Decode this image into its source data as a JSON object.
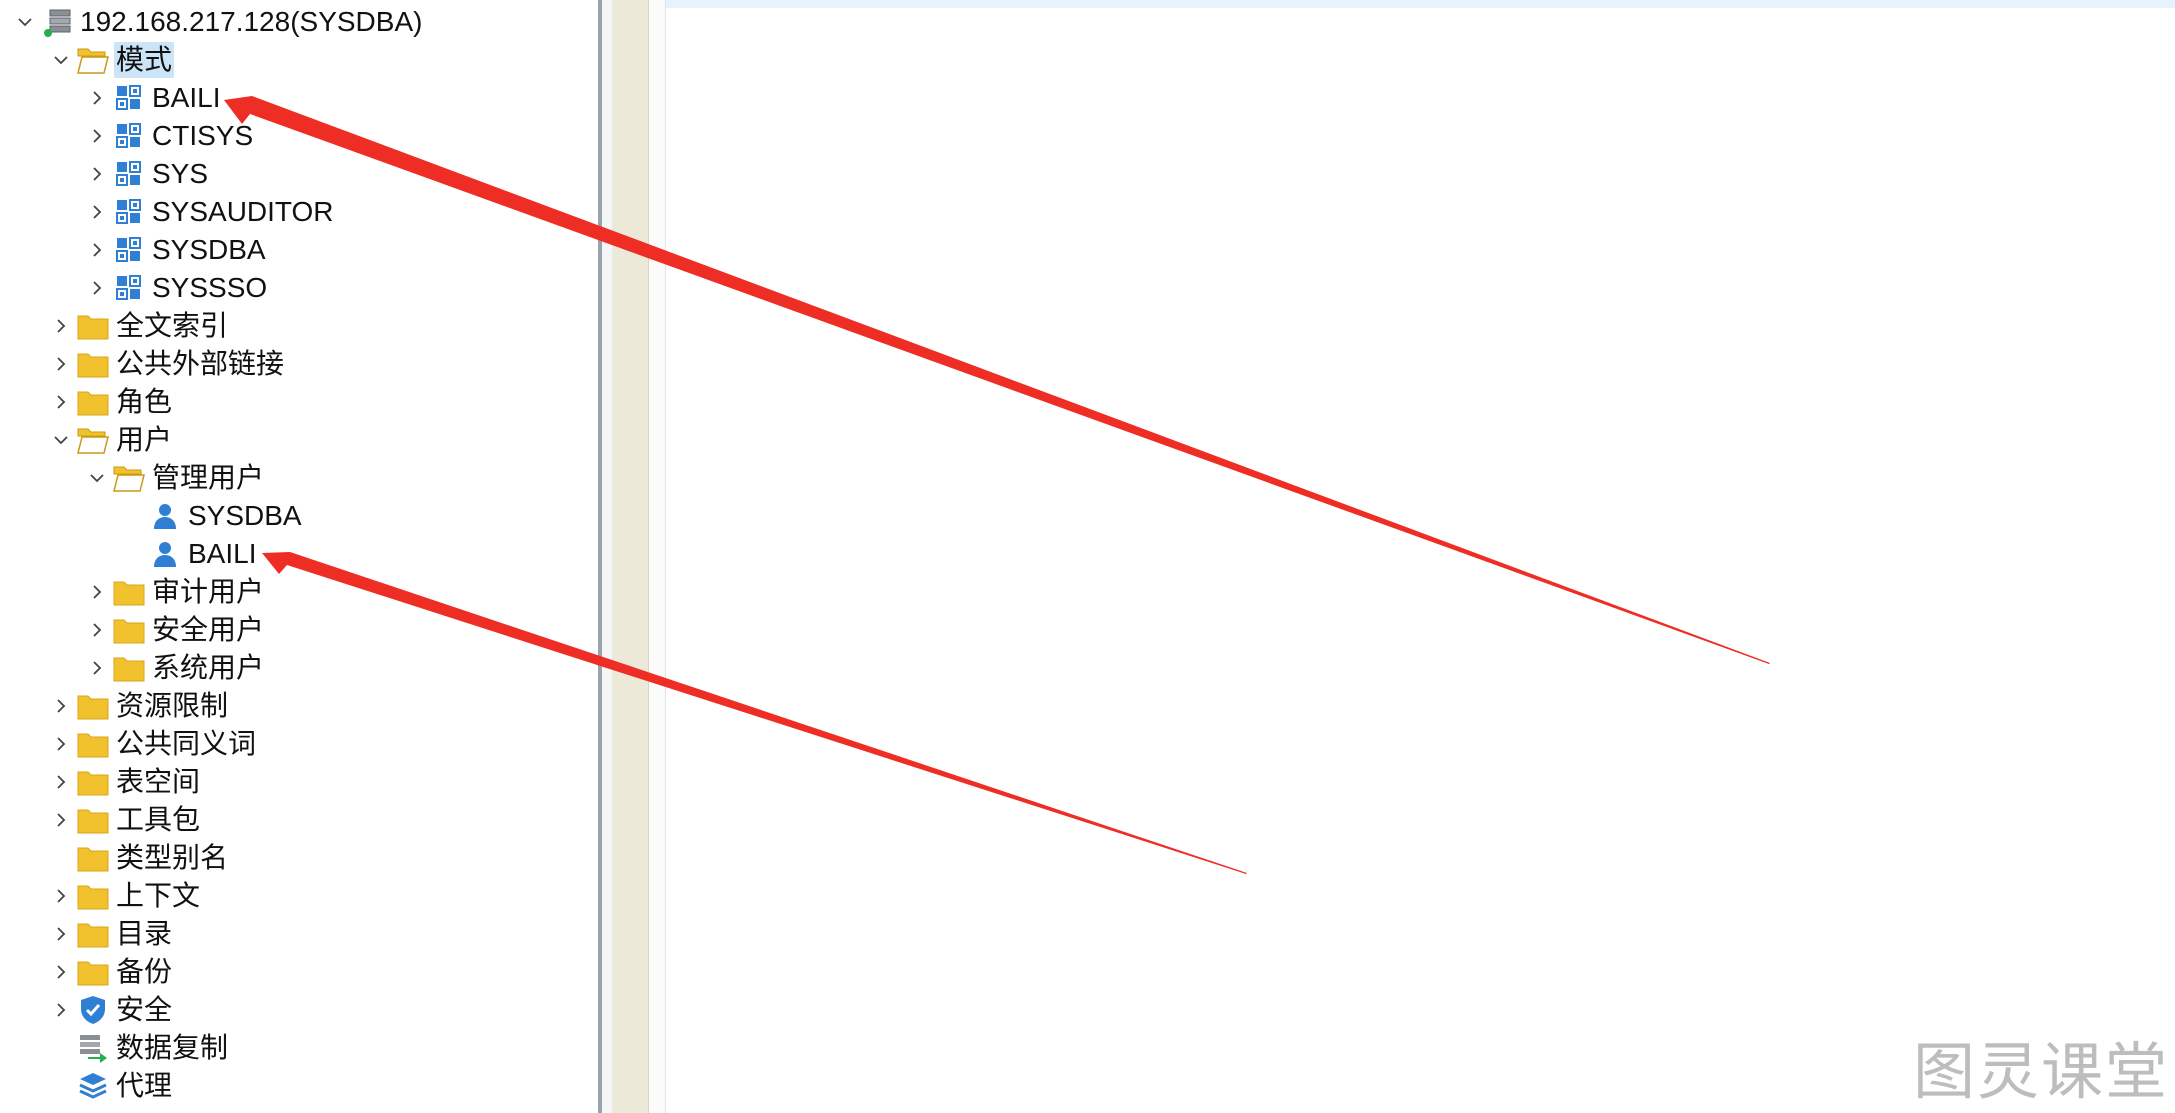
{
  "tree": {
    "connection": {
      "label": "192.168.217.128(SYSDBA)",
      "icon": "database-server-icon"
    },
    "schemas_folder": {
      "label": "模式",
      "icon": "folder-open-icon"
    },
    "schemas": [
      {
        "label": "BAILI",
        "icon": "schema-icon"
      },
      {
        "label": "CTISYS",
        "icon": "schema-icon"
      },
      {
        "label": "SYS",
        "icon": "schema-icon"
      },
      {
        "label": "SYSAUDITOR",
        "icon": "schema-icon"
      },
      {
        "label": "SYSDBA",
        "icon": "schema-icon"
      },
      {
        "label": "SYSSSO",
        "icon": "schema-icon"
      }
    ],
    "folders_a": [
      {
        "label": "全文索引",
        "icon": "folder-icon"
      },
      {
        "label": "公共外部链接",
        "icon": "folder-icon"
      },
      {
        "label": "角色",
        "icon": "folder-icon"
      }
    ],
    "users_folder": {
      "label": "用户",
      "icon": "folder-open-icon"
    },
    "admin_users_folder": {
      "label": "管理用户",
      "icon": "folder-open-icon"
    },
    "admin_users": [
      {
        "label": "SYSDBA",
        "icon": "user-icon"
      },
      {
        "label": "BAILI",
        "icon": "user-icon"
      }
    ],
    "user_folders": [
      {
        "label": "审计用户",
        "icon": "folder-icon"
      },
      {
        "label": "安全用户",
        "icon": "folder-icon"
      },
      {
        "label": "系统用户",
        "icon": "folder-icon"
      }
    ],
    "folders_b": [
      {
        "label": "资源限制",
        "icon": "folder-icon"
      },
      {
        "label": "公共同义词",
        "icon": "folder-icon"
      },
      {
        "label": "表空间",
        "icon": "folder-icon"
      },
      {
        "label": "工具包",
        "icon": "folder-icon"
      },
      {
        "label": "类型别名",
        "icon": "folder-icon"
      },
      {
        "label": "上下文",
        "icon": "folder-icon"
      },
      {
        "label": "目录",
        "icon": "folder-icon"
      },
      {
        "label": "备份",
        "icon": "folder-icon"
      }
    ],
    "security": {
      "label": "安全",
      "icon": "shield-icon"
    },
    "replication": {
      "label": "数据复制",
      "icon": "replication-icon"
    },
    "agent": {
      "label": "代理",
      "icon": "layers-icon"
    }
  },
  "colors": {
    "folder": "#f2c12e",
    "schema_blue": "#2f7fd4",
    "annotation_arrow": "#ee2e24",
    "selection": "#cce4f7"
  },
  "watermark": "图灵课堂"
}
